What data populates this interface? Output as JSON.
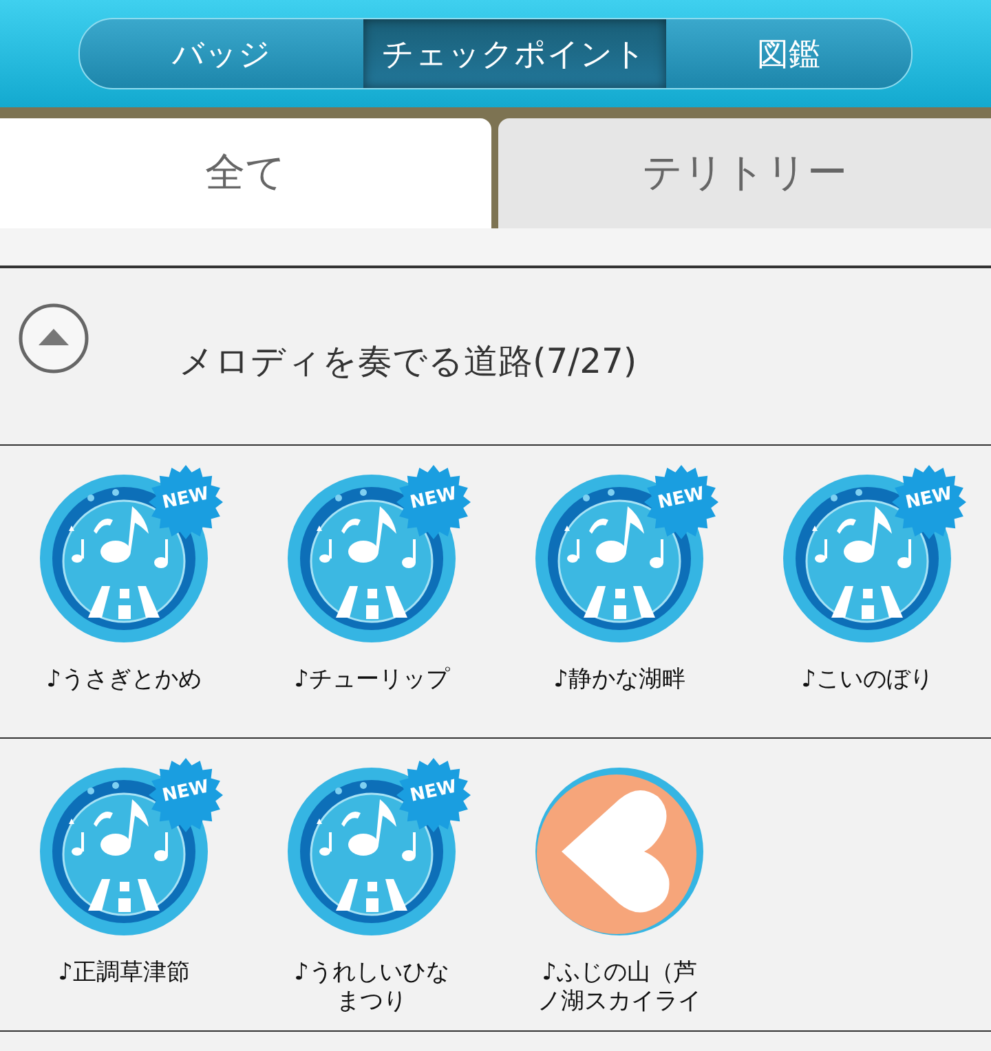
{
  "segments": [
    {
      "label": "バッジ",
      "selected": false
    },
    {
      "label": "チェックポイント",
      "selected": true
    },
    {
      "label": "図鑑",
      "selected": false
    }
  ],
  "tabs": [
    {
      "label": "全て",
      "selected": true
    },
    {
      "label": "テリトリー",
      "selected": false
    }
  ],
  "section": {
    "title": "メロディを奏でる道路(7/27)",
    "expanded": true
  },
  "rows": [
    {
      "items": [
        {
          "label": "♪うさぎとかめ",
          "kind": "melody",
          "badge": "NEW"
        },
        {
          "label": "♪チューリップ",
          "kind": "melody",
          "badge": "NEW"
        },
        {
          "label": "♪静かな湖畔",
          "kind": "melody",
          "badge": "NEW"
        },
        {
          "label": "♪こいのぼり",
          "kind": "melody",
          "badge": "NEW"
        }
      ]
    },
    {
      "items": [
        {
          "label": "♪正調草津節",
          "kind": "melody",
          "badge": "NEW"
        },
        {
          "label": "♪うれしいひなまつり",
          "kind": "melody",
          "badge": "NEW"
        },
        {
          "label": "♪ふじの山（芦ノ湖スカイライ",
          "kind": "heart"
        }
      ]
    }
  ]
}
